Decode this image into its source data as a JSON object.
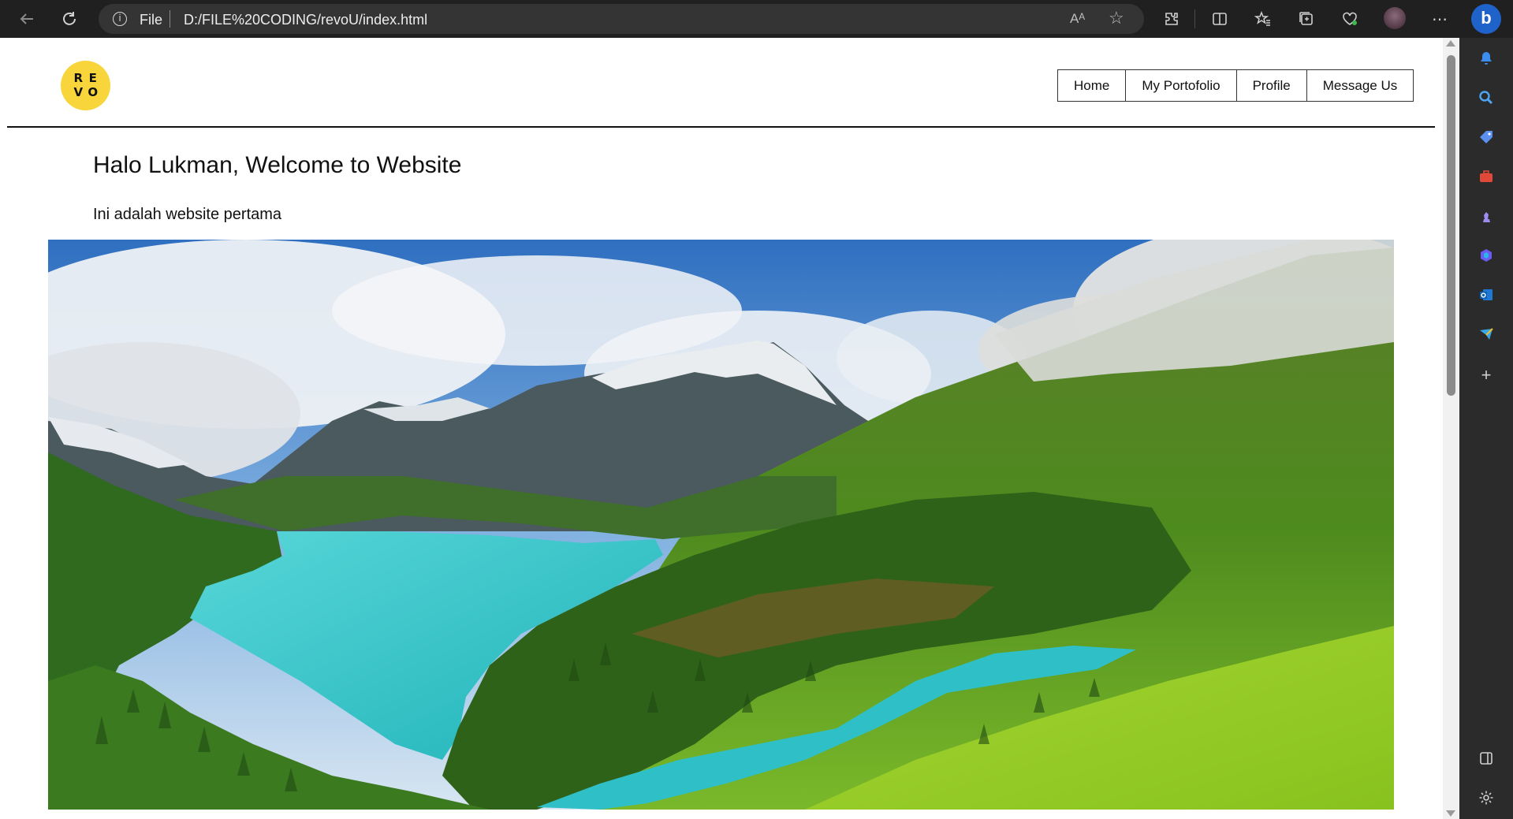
{
  "browser": {
    "scheme_label": "File",
    "url": "D:/FILE%20CODING/revoU/index.html",
    "read_aloud_icon": "Aᴬ"
  },
  "logo": {
    "letters": [
      "R",
      "E",
      "V",
      "O"
    ]
  },
  "nav": {
    "items": [
      "Home",
      "My Portofolio",
      "Profile",
      "Message Us"
    ]
  },
  "content": {
    "heading": "Halo Lukman, Welcome to Website",
    "paragraph": "Ini adalah website pertama"
  },
  "colors": {
    "logo_bg": "#f7d53b",
    "browser_bar": "#202020",
    "sidebar": "#2b2b2b"
  }
}
